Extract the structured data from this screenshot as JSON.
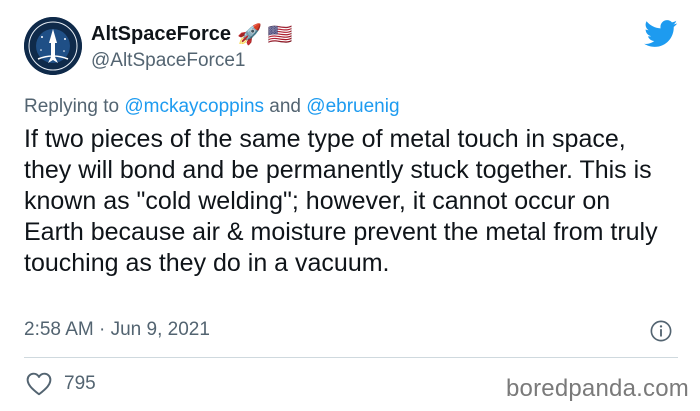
{
  "author": {
    "display_name": "AltSpaceForce",
    "emoji": "🚀 🇺🇸",
    "handle": "@AltSpaceForce1"
  },
  "reply": {
    "prefix": "Replying to ",
    "mention1": "@mckaycoppins",
    "joiner": " and ",
    "mention2": "@ebruenig"
  },
  "tweet": {
    "text": "If two pieces of the same type of metal touch in space, they will bond and be permanently stuck together. This is known as \"cold welding\"; however, it cannot occur on Earth because air & moisture prevent the metal from truly touching as they do in a vacuum.",
    "timestamp": "2:58 AM · Jun 9, 2021"
  },
  "engagement": {
    "likes": "795"
  },
  "watermark": "boredpanda.com",
  "colors": {
    "accent": "#1d9bf0",
    "secondary_text": "#536471",
    "primary_text": "#0f1419"
  },
  "icons": {
    "avatar": "space-force-logo",
    "brand": "twitter-bird-icon",
    "info": "info-icon",
    "like": "heart-icon"
  }
}
